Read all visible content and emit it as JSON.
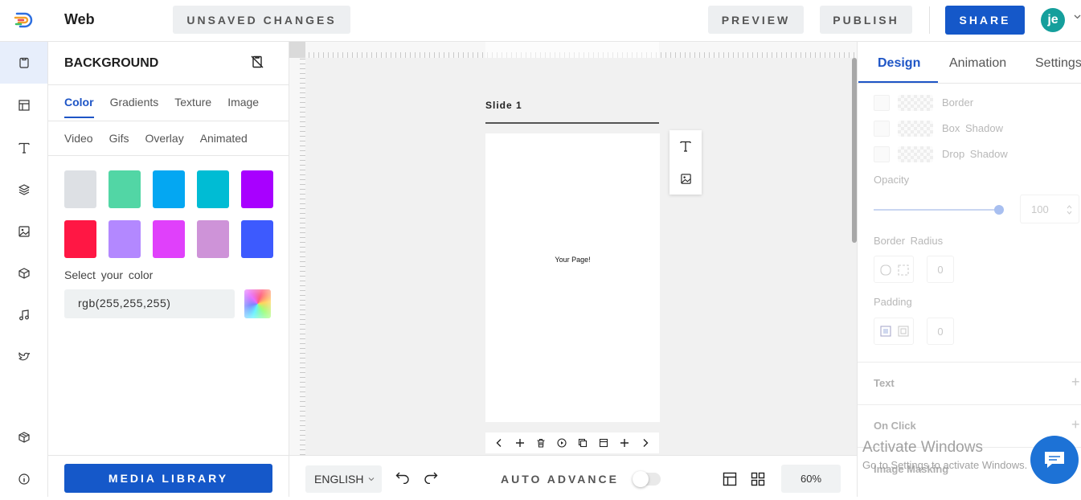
{
  "header": {
    "app_title": "Web",
    "unsaved_label": "UNSAVED CHANGES",
    "preview_label": "PREVIEW",
    "publish_label": "PUBLISH",
    "share_label": "SHARE",
    "avatar_initials": "je",
    "brand_color": "#1558c9",
    "avatar_color": "#159f9c"
  },
  "left_nav": {
    "items": [
      {
        "icon": "document-icon",
        "active": true
      },
      {
        "icon": "layout-icon"
      },
      {
        "icon": "text-icon"
      },
      {
        "icon": "layers-icon"
      },
      {
        "icon": "image-icon"
      },
      {
        "icon": "cube-icon"
      },
      {
        "icon": "music-icon"
      },
      {
        "icon": "twitter-icon"
      },
      {
        "icon": "package-icon"
      },
      {
        "icon": "info-icon"
      }
    ]
  },
  "background_panel": {
    "title": "BACKGROUND",
    "tabs_row1": [
      "Color",
      "Gradients",
      "Texture",
      "Image"
    ],
    "tabs_row2": [
      "Video",
      "Gifs",
      "Overlay",
      "Animated"
    ],
    "active_tab": "Color",
    "swatches": [
      "#dde0e4",
      "#52d6a5",
      "#04a7f2",
      "#00bcd4",
      "#a800ff",
      "#ff1744",
      "#b388ff",
      "#e040fb",
      "#ce93d8",
      "#3d5afe"
    ],
    "select_label": "Select your color",
    "color_value": "rgb(255,255,255)",
    "media_library_label": "MEDIA LIBRARY"
  },
  "canvas": {
    "slide_label": "Slide 1",
    "slide_text": "Your Page!",
    "float_tools": [
      "text-icon",
      "image-icon"
    ],
    "slide_toolbar": [
      "chevron-left-icon",
      "plus-icon",
      "trash-icon",
      "play-icon",
      "copy-icon",
      "layout-icon",
      "plus-icon",
      "chevron-right-icon"
    ]
  },
  "bottom_bar": {
    "language": "ENGLISH",
    "auto_advance_label": "AUTO ADVANCE",
    "auto_advance_on": false,
    "zoom": "60%"
  },
  "right_panel": {
    "tabs": [
      "Design",
      "Animation",
      "Settings"
    ],
    "active_tab": "Design",
    "effects": [
      "Border",
      "Box Shadow",
      "Drop Shadow"
    ],
    "opacity_label": "Opacity",
    "opacity_value": "100",
    "border_radius_label": "Border Radius",
    "border_radius_value": "0",
    "padding_label": "Padding",
    "padding_value": "0",
    "sections": [
      "Text",
      "On Click",
      "Image Masking"
    ]
  },
  "os_overlay": {
    "title": "Activate Windows",
    "subtitle": "Go to Settings to activate Windows."
  }
}
